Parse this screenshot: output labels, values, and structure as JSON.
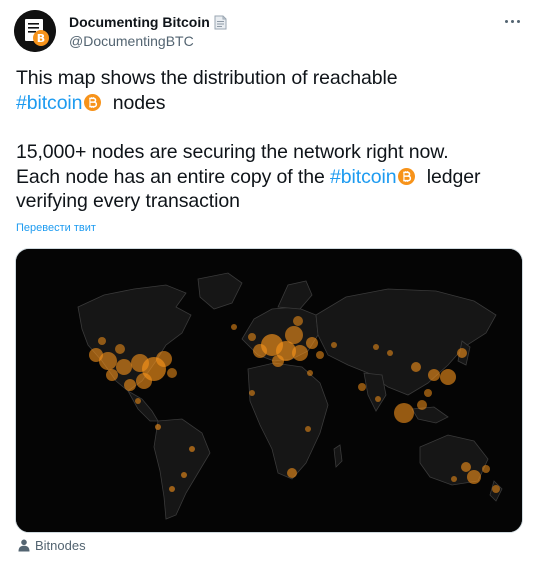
{
  "author": {
    "display_name": "Documenting Bitcoin",
    "handle": "@DocumentingBTC",
    "avatar_icon": "bitcoin-document-avatar",
    "badge_icon": "document-emoji-icon"
  },
  "menu": {
    "more_icon": "more-horizontal-icon"
  },
  "tweet": {
    "line1": "This map shows the distribution of reachable",
    "line2_hashtag": "#bitcoin",
    "line2_rest": " nodes",
    "line3": "15,000+ nodes are securing the network right now.",
    "line4_prefix": "Each node has an entire copy of the ",
    "line4_hashtag": "#bitcoin",
    "line4_suffix": " ledger",
    "line5": "verifying every transaction",
    "emoji_icon": "bitcoin-emoji-icon"
  },
  "translate_link": "Перевести твит",
  "media": {
    "type": "world-map",
    "description_icon": "world-map-image",
    "node_color": "#f7931a"
  },
  "attribution": {
    "icon": "person-icon",
    "label": "Bitnodes"
  },
  "colors": {
    "accent": "#1d9bf0",
    "text_primary": "#0f1419",
    "text_secondary": "#536471",
    "bitcoin_orange": "#f7931a"
  }
}
